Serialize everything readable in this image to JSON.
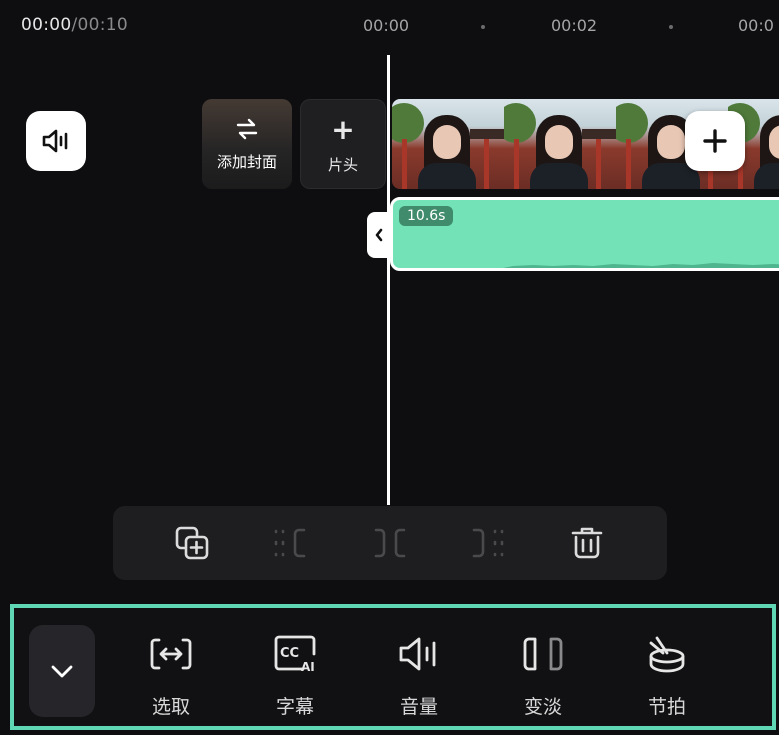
{
  "timecode": {
    "current": "00:00",
    "separator": "/",
    "total": "00:10"
  },
  "ruler": {
    "marks": [
      "00:00",
      "00:02",
      "00:0"
    ]
  },
  "cover": {
    "label": "添加封面"
  },
  "intro": {
    "plus": "+",
    "label": "片头"
  },
  "audio_clip": {
    "duration": "10.6s",
    "color": "#73e3b7"
  },
  "tools": [
    {
      "id": "select",
      "label": "选取",
      "icon": "select-range-icon"
    },
    {
      "id": "subtitles",
      "label": "字幕",
      "icon": "cc-ai-icon"
    },
    {
      "id": "volume",
      "label": "音量",
      "icon": "volume-icon"
    },
    {
      "id": "fade",
      "label": "变淡",
      "icon": "fade-icon"
    },
    {
      "id": "beat",
      "label": "节拍",
      "icon": "beat-drum-icon"
    }
  ],
  "edit_actions": [
    "duplicate-icon",
    "split-left-icon",
    "split-icon",
    "split-right-icon",
    "trash-icon"
  ],
  "colors": {
    "accent": "#5fd6b4",
    "background": "#0e0e10"
  }
}
